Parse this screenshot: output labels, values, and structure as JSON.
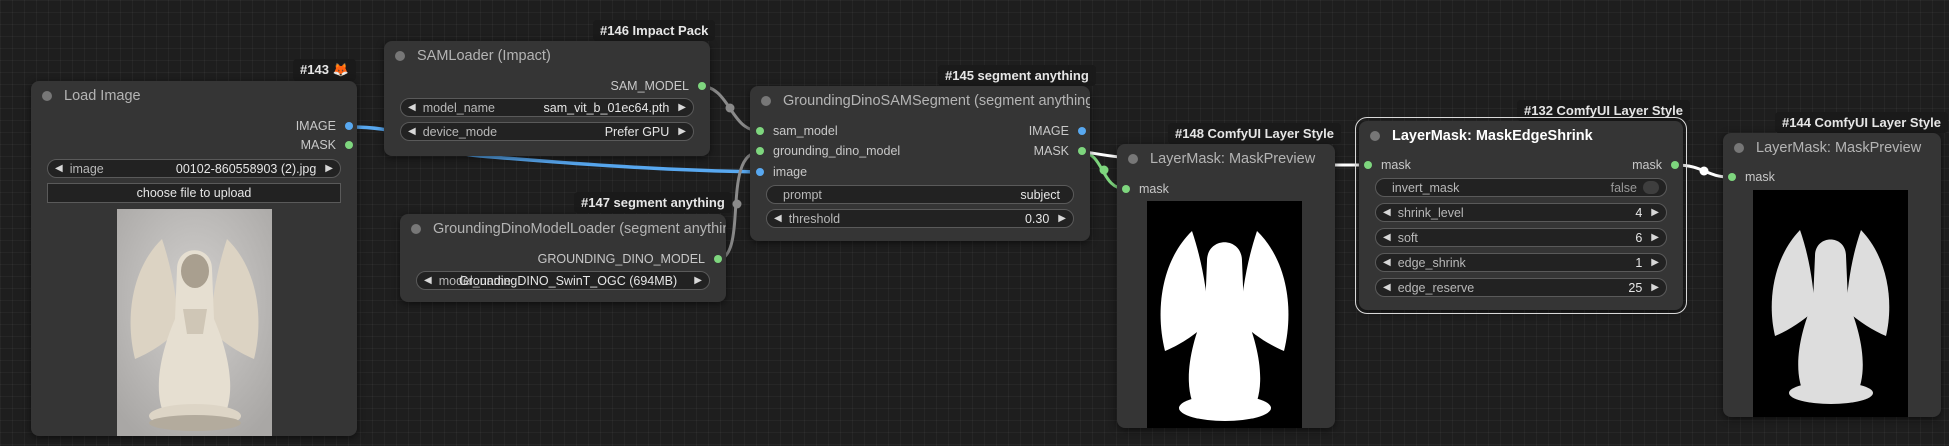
{
  "nodes": {
    "load_image": {
      "badge": "#143",
      "badge_icon": "fox-icon",
      "title": "Load Image",
      "outputs": [
        "IMAGE",
        "MASK"
      ],
      "image_label": "image",
      "image_value": "00102-860558903 (2).jpg",
      "upload_button": "choose file to upload"
    },
    "sam_loader": {
      "badge": "#146 Impact Pack",
      "title": "SAMLoader (Impact)",
      "output": "SAM_MODEL",
      "model_name_label": "model_name",
      "model_name_value": "sam_vit_b_01ec64.pth",
      "device_mode_label": "device_mode",
      "device_mode_value": "Prefer GPU"
    },
    "grounding_loader": {
      "badge": "#147 segment anything",
      "title": "GroundingDinoModelLoader (segment anything)",
      "output": "GROUNDING_DINO_MODEL",
      "model_label": "model_name",
      "model_value": "GroundingDINO_SwinT_OGC (694MB)"
    },
    "sam_segment": {
      "badge": "#145 segment anything",
      "title": "GroundingDinoSAMSegment (segment anything)",
      "inputs": [
        "sam_model",
        "grounding_dino_model",
        "image"
      ],
      "outputs": [
        "IMAGE",
        "MASK"
      ],
      "prompt_label": "prompt",
      "prompt_value": "subject",
      "threshold_label": "threshold",
      "threshold_value": "0.30"
    },
    "mask_preview_1": {
      "badge": "#148 ComfyUI Layer Style",
      "title": "LayerMask: MaskPreview",
      "input": "mask"
    },
    "edge_shrink": {
      "badge": "#132 ComfyUI Layer Style",
      "title": "LayerMask: MaskEdgeShrink",
      "input": "mask",
      "output": "mask",
      "widgets": [
        {
          "label": "invert_mask",
          "value": "false"
        },
        {
          "label": "shrink_level",
          "value": "4"
        },
        {
          "label": "soft",
          "value": "6"
        },
        {
          "label": "edge_shrink",
          "value": "1"
        },
        {
          "label": "edge_reserve",
          "value": "25"
        }
      ]
    },
    "mask_preview_2": {
      "badge": "#144 ComfyUI Layer Style",
      "title": "LayerMask: MaskPreview",
      "input": "mask"
    }
  },
  "colors": {
    "image_link": "#58a8f0",
    "mask_link": "#7ed67e",
    "generic_link": "#8a8a8a"
  }
}
